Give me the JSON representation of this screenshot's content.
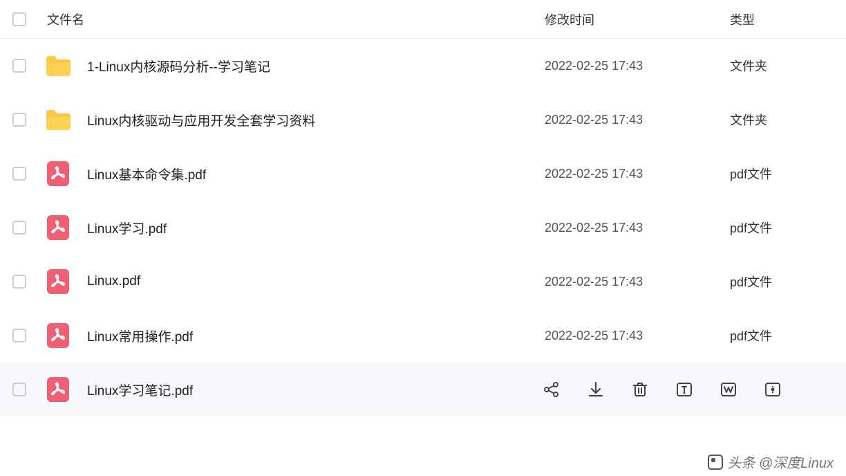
{
  "columns": {
    "name": "文件名",
    "time": "修改时间",
    "type": "类型"
  },
  "rows": [
    {
      "icon": "folder",
      "name": "1-Linux内核源码分析--学习笔记",
      "time": "2022-02-25 17:43",
      "type": "文件夹"
    },
    {
      "icon": "folder",
      "name": "Linux内核驱动与应用开发全套学习资料",
      "time": "2022-02-25 17:43",
      "type": "文件夹"
    },
    {
      "icon": "pdf",
      "name": "Linux基本命令集.pdf",
      "time": "2022-02-25 17:43",
      "type": "pdf文件"
    },
    {
      "icon": "pdf",
      "name": "Linux学习.pdf",
      "time": "2022-02-25 17:43",
      "type": "pdf文件"
    },
    {
      "icon": "pdf",
      "name": "Linux.pdf",
      "time": "2022-02-25 17:43",
      "type": "pdf文件"
    },
    {
      "icon": "pdf",
      "name": "Linux常用操作.pdf",
      "time": "2022-02-25 17:43",
      "type": "pdf文件"
    },
    {
      "icon": "pdf",
      "name": "Linux学习笔记.pdf",
      "time": "",
      "type": "",
      "hover": true
    }
  ],
  "watermark": "头条 @深度Linux"
}
